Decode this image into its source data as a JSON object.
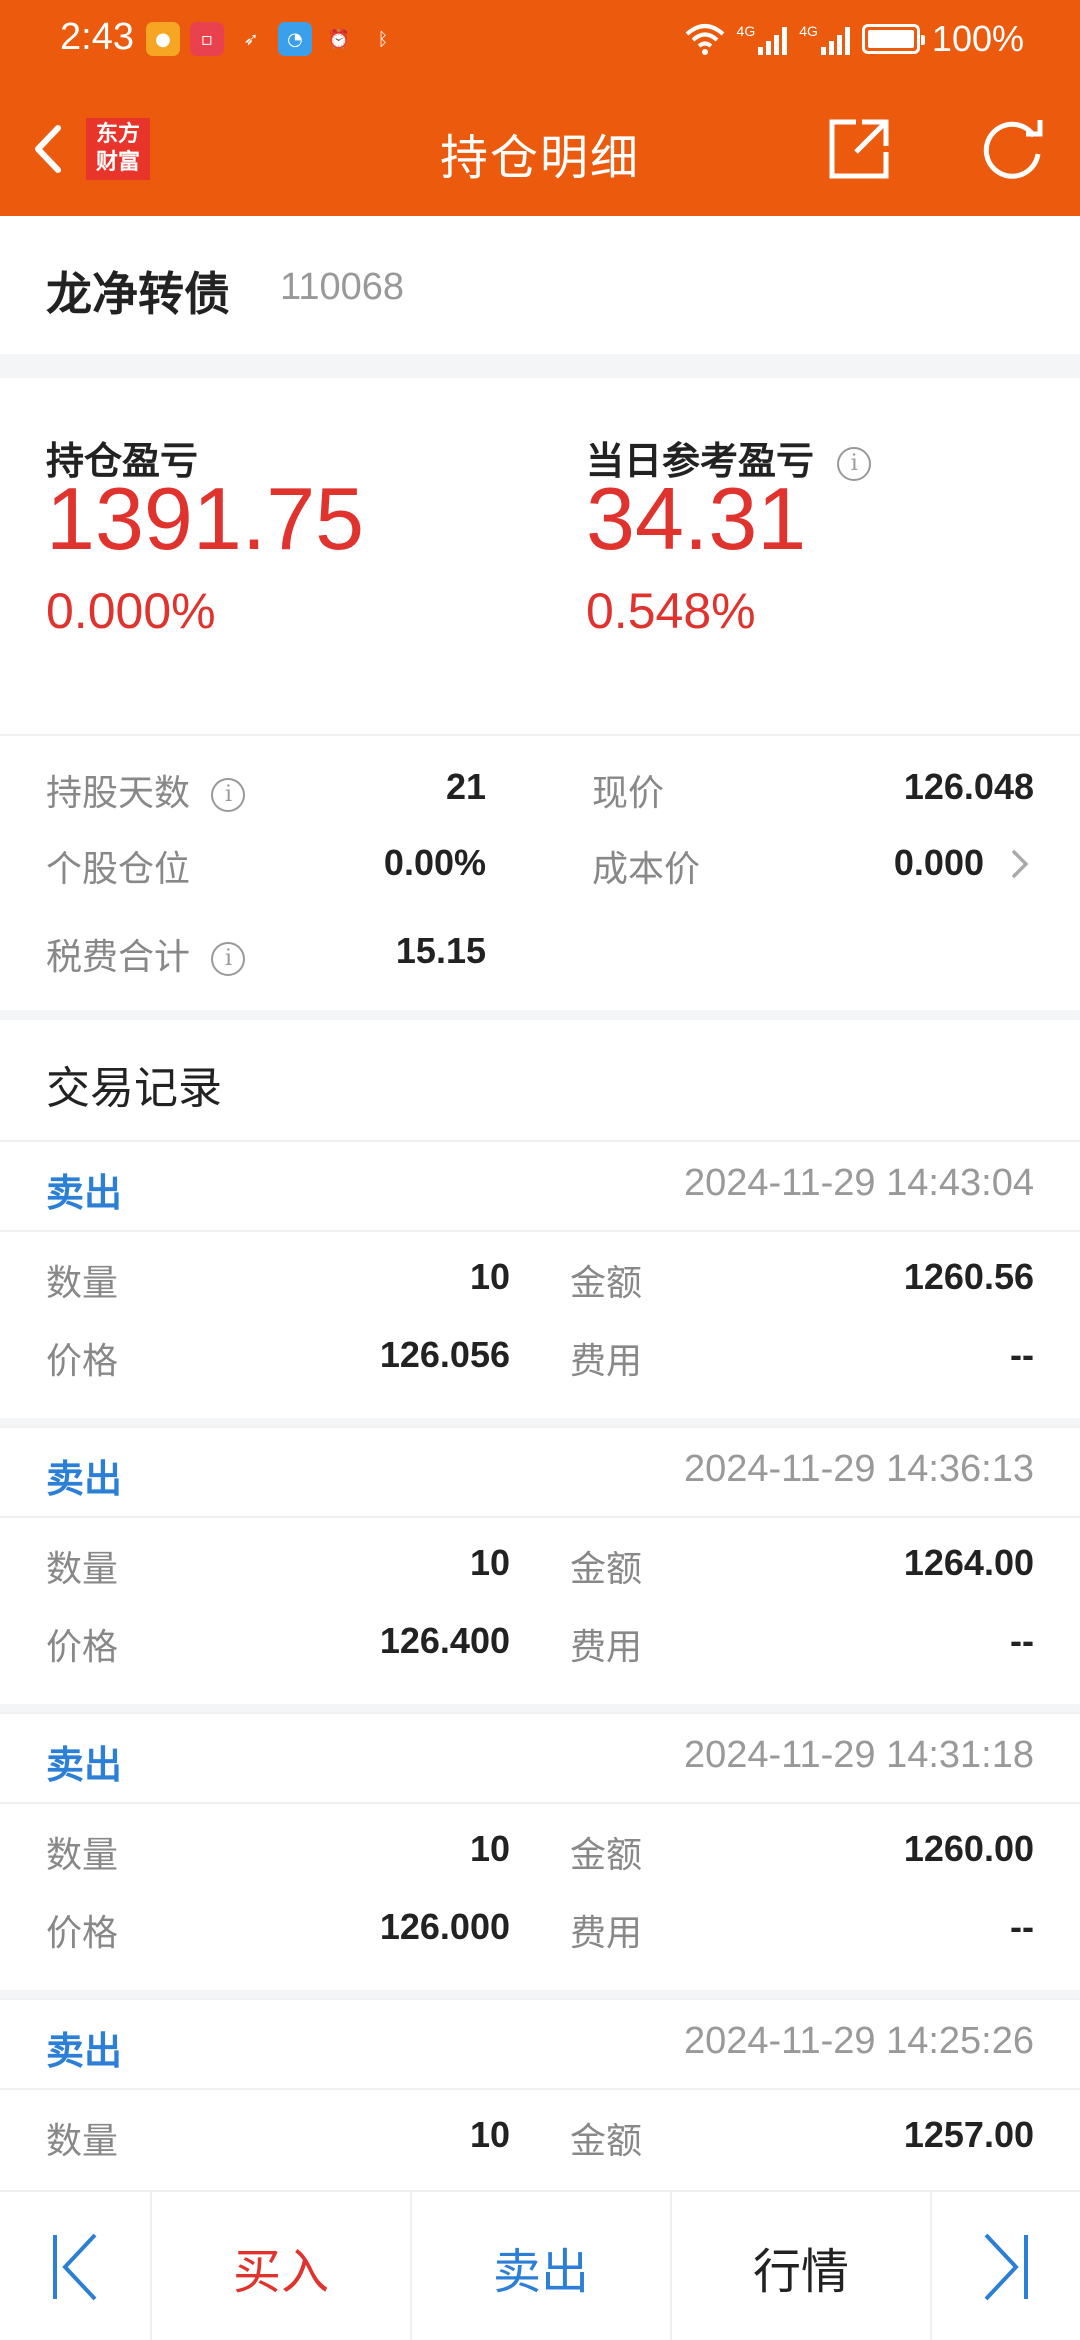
{
  "status_bar": {
    "time": "2:43",
    "battery": "100%",
    "battery_level": 1.0,
    "network_labels": [
      "4G",
      "4G"
    ]
  },
  "nav": {
    "logo_line1": "东方",
    "logo_line2": "财富",
    "title": "持仓明细",
    "icons": [
      "back-icon",
      "share-icon",
      "refresh-icon"
    ]
  },
  "stock": {
    "name": "龙净转债",
    "code": "110068"
  },
  "summary": {
    "hold_pnl_label": "持仓盈亏",
    "hold_pnl_value": "1391.75",
    "hold_pnl_pct": "0.000%",
    "day_pnl_label": "当日参考盈亏",
    "day_pnl_value": "34.31",
    "day_pnl_pct": "0.548%",
    "info_glyph": "i",
    "details": {
      "days_label": "持股天数",
      "days_value": "21",
      "price_label": "现价",
      "price_value": "126.048",
      "position_label": "个股仓位",
      "position_value": "0.00%",
      "cost_label": "成本价",
      "cost_value": "0.000",
      "fee_label": "税费合计",
      "fee_value": "15.15"
    }
  },
  "records": {
    "title": "交易记录",
    "labels": {
      "qty": "数量",
      "price": "价格",
      "amount": "金额",
      "fee": "费用"
    },
    "items": [
      {
        "type": "卖出",
        "time": "2024-11-29 14:43:04",
        "qty": "10",
        "price": "126.056",
        "amount": "1260.56",
        "fee": "--"
      },
      {
        "type": "卖出",
        "time": "2024-11-29 14:36:13",
        "qty": "10",
        "price": "126.400",
        "amount": "1264.00",
        "fee": "--"
      },
      {
        "type": "卖出",
        "time": "2024-11-29 14:31:18",
        "qty": "10",
        "price": "126.000",
        "amount": "1260.00",
        "fee": "--"
      },
      {
        "type": "卖出",
        "time": "2024-11-29 14:25:26",
        "qty": "10",
        "price": "",
        "amount": "1257.00",
        "fee": ""
      }
    ]
  },
  "bottom_bar": {
    "buy": "买入",
    "sell": "卖出",
    "quote": "行情"
  },
  "colors": {
    "brand": "#ec5a0e",
    "profit_red": "#e0332e",
    "sell_blue": "#2c7fd6",
    "buy_red": "#e0332e"
  }
}
